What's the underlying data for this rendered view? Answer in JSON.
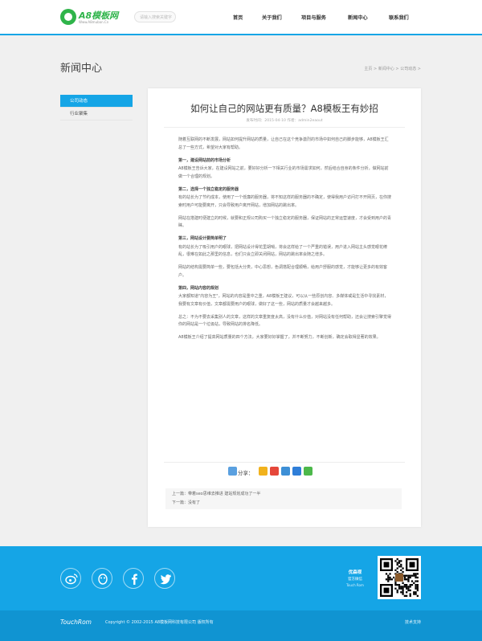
{
  "header": {
    "logo_text": "A8模板网",
    "logo_sub": "Www.A8muban.Cn",
    "search_placeholder": "请输入搜索关键字",
    "nav": [
      "首页",
      "关于我们",
      "项目与服务",
      "新闻中心",
      "联系我们"
    ]
  },
  "page": {
    "title": "新闻中心",
    "breadcrumb": [
      "主页",
      "新闻中心",
      "公司动态"
    ]
  },
  "sidebar": {
    "items": [
      {
        "label": "公司动态",
        "active": true
      },
      {
        "label": "行业聚集",
        "active": false
      }
    ]
  },
  "article": {
    "title": "如何让自己的网站更有质量？A8模板王有妙招",
    "meta": "发布时间：2015-04-10  作者：admin2eaout",
    "paragraphs": [
      {
        "kind": "p",
        "text": "随着互联网的不断发展，网站如何提升网站的质量，让自己在这个竞争激烈的市场中如何自己的脚步能够，A8模板王汇总了一些方式，希望对大家有帮助。"
      },
      {
        "kind": "h",
        "text": "第一，建设网站前的市场分析"
      },
      {
        "kind": "p",
        "text": "A8模板王告诉大家，在建设网站之前，要好好分析一下相关行业的市场需求如何，然后结合自身的条件分析，做网站前做一个合理的规划。"
      },
      {
        "kind": "h",
        "text": "第二，选择一个独立稳定的服务器"
      },
      {
        "kind": "p",
        "text": "有的站长为了节约成本，使用了一个低廉的服务器，将不知这样的服务器的不确定，使得我用户访问打不开网页，在你搜索时用户可能要离开，只会导致用户离开网站，增加网站的跳出率。"
      },
      {
        "kind": "p",
        "text": "网站在搭建时便建立的时候，就要和正规公司购买一个独立稳定的服务器，保证网站的正常运营速度，才会受到用户的青睐。"
      },
      {
        "kind": "h",
        "text": "第三，网站设计要简单明了"
      },
      {
        "kind": "p",
        "text": "有的站长为了吸引用户的眼球，把网站设计得花里胡哨，将会这样给了一个严重的错误，用户进入网站主头感觉眼花缭乱，很难在如此之那里的信息，也们只会立即关闭网站，网站的跳出率会随之增多。"
      },
      {
        "kind": "p",
        "text": "网站的结构需要简单一些，要包括大分类，中心思想，色调搭配合理顺畅，给用户舒服的感觉，才能够让更多的有效客户。"
      },
      {
        "kind": "h",
        "text": "第四，网站内容的规划"
      },
      {
        "kind": "p",
        "text": "大家都知道\"内容为王\"，网站的内容是重中之重，A8模板王建议，可以从一些原创内容、多媒体或是生活中寻找素材，我要有文章有价值，文章都需要用户的眼球，做好了这一些，网站的质量才会越来越多。"
      },
      {
        "kind": "p",
        "text": "总之：不为不要去采集别人的文章，这样的文章重复度太高，没有什么价值，对网站没有任何帮助，还会让搜索引擎觉得你的网站是一个垃圾站，导致网站的排名降低。"
      },
      {
        "kind": "p",
        "text": "A8模板王介绍了提高网站质量的四个方法，大家要好好掌握了，并不断努力，不断创新，确定会取得显著的效果。"
      }
    ],
    "share_label": "分享：",
    "prev": "上一篇：带着seo思维去推进 建站规划成功了一半",
    "next": "下一篇：没有了"
  },
  "footer": {
    "follow_title": "优森视",
    "follow_line2": "官方微信",
    "follow_line3": "Touch Rom",
    "copy_logo": "TouchRom",
    "copyright": "Copyright © 2002-2015 A8模板网科技有限公司 版权所有",
    "right_link": "技术支持"
  },
  "colors": {
    "accent": "#15a5e6",
    "logo_green": "#2fb44a"
  }
}
